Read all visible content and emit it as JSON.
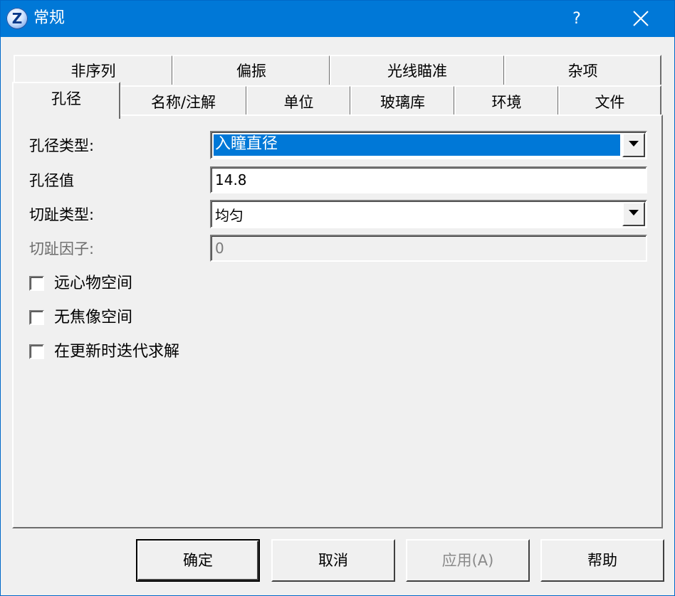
{
  "window": {
    "title": "常规"
  },
  "titlebar": {
    "icon_letter": "Z",
    "help_label": "?"
  },
  "tabs_row1": [
    "非序列",
    "偏振",
    "光线瞄准",
    "杂项"
  ],
  "tabs_row2": [
    "孔径",
    "名称/注解",
    "单位",
    "玻璃库",
    "环境",
    "文件"
  ],
  "active_tab": "孔径",
  "form": {
    "aperture_type": {
      "label": "孔径类型:",
      "value": "入瞳直径"
    },
    "aperture_value": {
      "label": "孔径值",
      "value": "14.8"
    },
    "apodization_type": {
      "label": "切趾类型:",
      "value": "均匀"
    },
    "apodization_factor": {
      "label": "切趾因子:",
      "value": "0"
    }
  },
  "checkboxes": [
    {
      "label": "远心物空间",
      "checked": false
    },
    {
      "label": "无焦像空间",
      "checked": false
    },
    {
      "label": "在更新时迭代求解",
      "checked": false
    }
  ],
  "buttons": {
    "ok": "确定",
    "cancel": "取消",
    "apply": "应用(A)",
    "help": "帮助"
  },
  "colors": {
    "titlebar": "#0078d7",
    "selection": "#0078d7",
    "face": "#f0f0f0"
  }
}
